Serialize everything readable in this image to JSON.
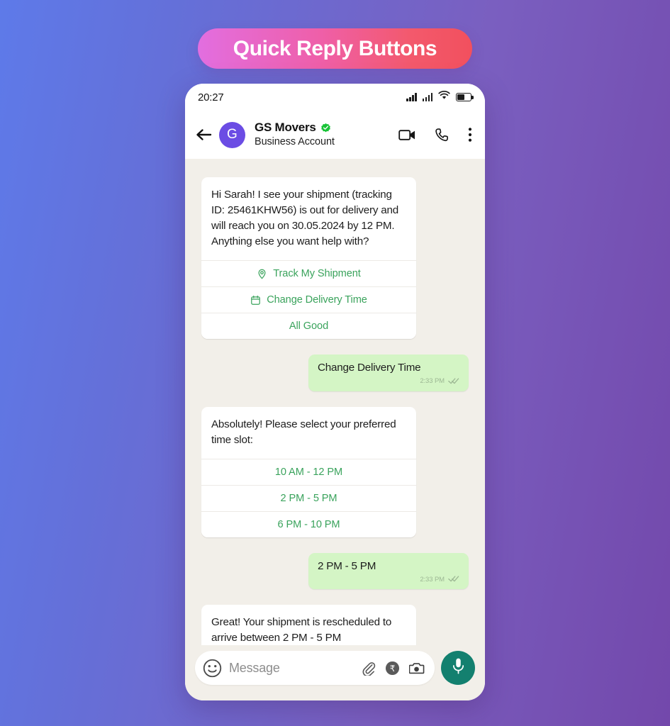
{
  "banner": {
    "title": "Quick Reply Buttons"
  },
  "status_bar": {
    "time": "20:27",
    "icons": [
      "signal-icon",
      "signal-icon",
      "wifi-icon",
      "battery-icon"
    ]
  },
  "chat_header": {
    "back_icon": "back-arrow-icon",
    "avatar_initial": "G",
    "avatar_color": "#6b4ce4",
    "contact_name": "GS Movers",
    "verified_badge": "verified-badge-icon",
    "verified_color": "#19c337",
    "contact_subtitle": "Business Account",
    "actions": [
      {
        "name": "video-call-icon",
        "label": "Video call"
      },
      {
        "name": "voice-call-icon",
        "label": "Voice call"
      },
      {
        "name": "more-options-icon",
        "label": "More options"
      }
    ]
  },
  "theme": {
    "quick_reply_green": "#3aa35c",
    "outgoing_bubble": "#d4f5c5",
    "chat_background": "#f2efe9",
    "mic_button": "#13806f"
  },
  "conversation": [
    {
      "type": "incoming_card",
      "text": "Hi Sarah! I see your shipment (tracking ID: 25461KHW56) is out for delivery and will reach you on 30.05.2024 by 12 PM. Anything else you want help with?",
      "quick_replies": [
        {
          "label": "Track My Shipment",
          "icon": "location-pin-icon"
        },
        {
          "label": "Change Delivery Time",
          "icon": "calendar-icon"
        },
        {
          "label": "All Good",
          "icon": ""
        }
      ]
    },
    {
      "type": "outgoing",
      "text": "Change Delivery Time",
      "time": "2:33 PM",
      "status_icon": "double-check-icon"
    },
    {
      "type": "incoming_card",
      "text": "Absolutely! Please select your preferred time slot:",
      "quick_replies": [
        {
          "label": "10 AM - 12 PM",
          "icon": ""
        },
        {
          "label": "2 PM - 5 PM",
          "icon": ""
        },
        {
          "label": "6 PM - 10 PM",
          "icon": ""
        }
      ]
    },
    {
      "type": "outgoing",
      "text": "2 PM - 5 PM",
      "time": "2:33 PM",
      "status_icon": "double-check-icon"
    },
    {
      "type": "incoming_plain",
      "text": "Great! Your shipment is rescheduled to arrive between 2 PM - 5 PM"
    }
  ],
  "input_bar": {
    "emoji_icon": "emoji-icon",
    "placeholder": "Message",
    "actions": [
      {
        "name": "attach-icon",
        "label": "Attach"
      },
      {
        "name": "payment-rupee-icon",
        "label": "₹"
      },
      {
        "name": "camera-icon",
        "label": "Camera"
      }
    ],
    "mic_icon": "microphone-icon"
  }
}
